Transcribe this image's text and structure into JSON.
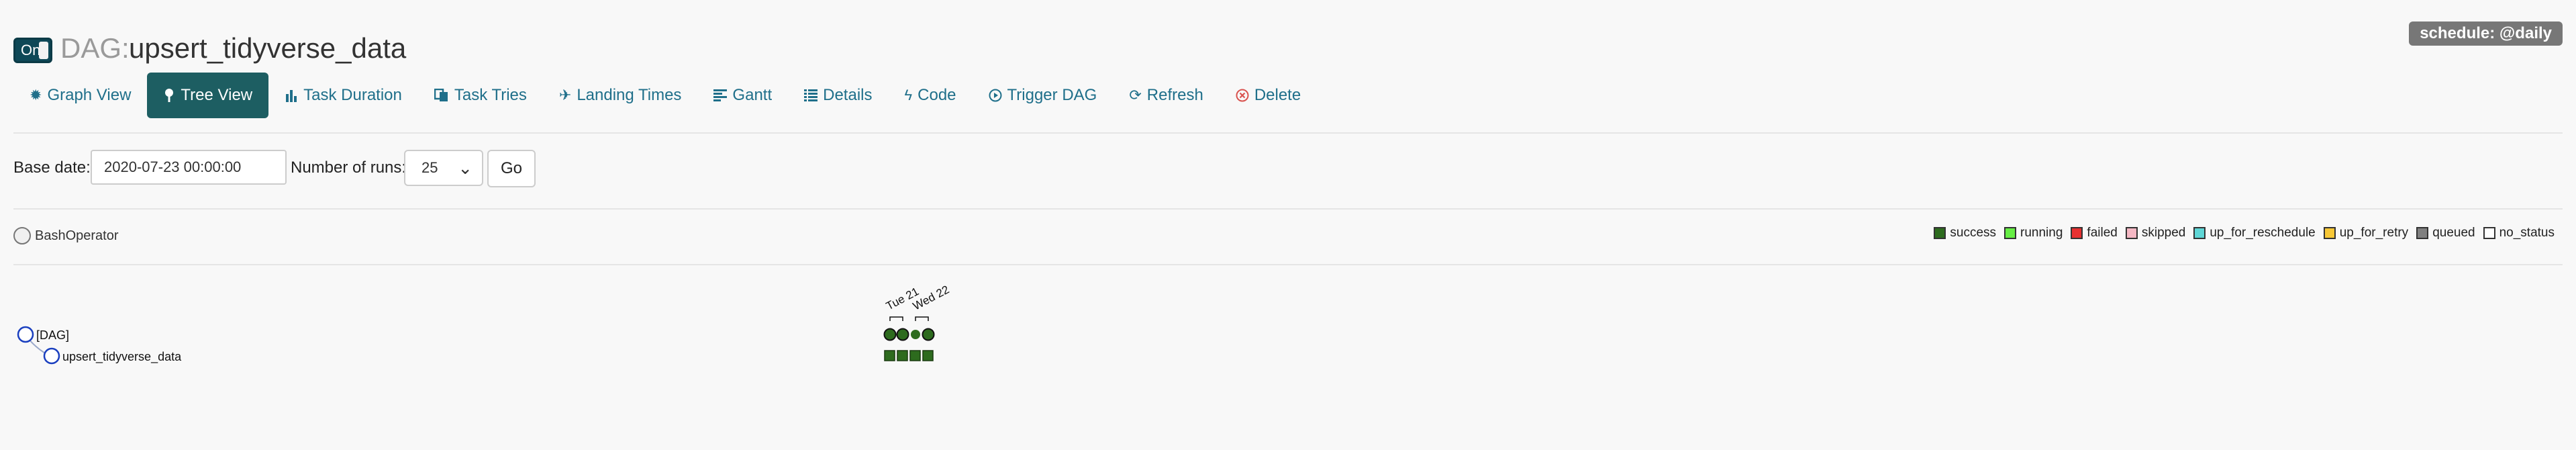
{
  "header": {
    "toggle_label": "On",
    "title_prefix": "DAG:",
    "dag_id": "upsert_tidyverse_data",
    "schedule": "schedule: @daily"
  },
  "nav": {
    "items": [
      {
        "label": "Graph View",
        "icon": "graph-icon"
      },
      {
        "label": "Tree View",
        "icon": "tree-icon",
        "active": true
      },
      {
        "label": "Task Duration",
        "icon": "bar-chart-icon"
      },
      {
        "label": "Task Tries",
        "icon": "duplicate-icon"
      },
      {
        "label": "Landing Times",
        "icon": "plane-icon"
      },
      {
        "label": "Gantt",
        "icon": "align-left-icon"
      },
      {
        "label": "Details",
        "icon": "list-icon"
      },
      {
        "label": "Code",
        "icon": "flash-icon"
      },
      {
        "label": "Trigger DAG",
        "icon": "play-circle-icon"
      },
      {
        "label": "Refresh",
        "icon": "refresh-icon"
      },
      {
        "label": "Delete",
        "icon": "remove-circle-icon"
      }
    ]
  },
  "form": {
    "base_date_label": "Base date:",
    "base_date_value": "2020-07-23 00:00:00",
    "runs_label": "Number of runs:",
    "runs_value": "25",
    "go_label": "Go"
  },
  "operator_legend": {
    "label": "BashOperator"
  },
  "status_legend": [
    {
      "label": "success",
      "color": "#2d6b1e"
    },
    {
      "label": "running",
      "color": "#66ee44"
    },
    {
      "label": "failed",
      "color": "#e63030"
    },
    {
      "label": "skipped",
      "color": "#f5b8c4"
    },
    {
      "label": "up_for_reschedule",
      "color": "#5fd6d6"
    },
    {
      "label": "up_for_retry",
      "color": "#f7c736"
    },
    {
      "label": "queued",
      "color": "#808080"
    },
    {
      "label": "no_status",
      "color": "#ffffff"
    }
  ],
  "tree": {
    "dag_label": "[DAG]",
    "task_label": "upsert_tidyverse_data",
    "date_labels": [
      "Tue 21",
      "Wed 22"
    ],
    "run_statuses": [
      "success",
      "success",
      "success",
      "success"
    ],
    "task_statuses": [
      "success",
      "success",
      "success",
      "success"
    ]
  }
}
